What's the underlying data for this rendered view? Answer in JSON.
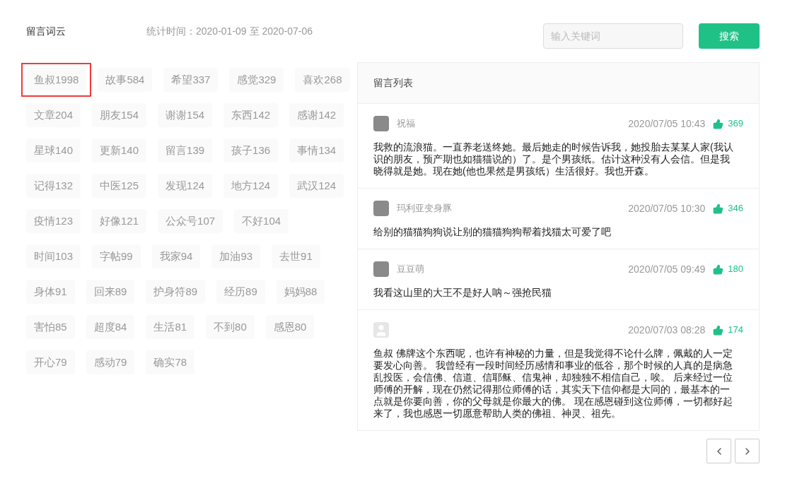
{
  "cloud": {
    "title": "留言词云",
    "stats_period": "统计时间：2020-01-09 至 2020-07-06",
    "tags": [
      {
        "label": "鱼叔1998",
        "selected": true
      },
      {
        "label": "故事584",
        "selected": false
      },
      {
        "label": "希望337",
        "selected": false
      },
      {
        "label": "感觉329",
        "selected": false
      },
      {
        "label": "喜欢268",
        "selected": false
      },
      {
        "label": "文章204",
        "selected": false
      },
      {
        "label": "朋友154",
        "selected": false
      },
      {
        "label": "谢谢154",
        "selected": false
      },
      {
        "label": "东西142",
        "selected": false
      },
      {
        "label": "感谢142",
        "selected": false
      },
      {
        "label": "星球140",
        "selected": false
      },
      {
        "label": "更新140",
        "selected": false
      },
      {
        "label": "留言139",
        "selected": false
      },
      {
        "label": "孩子136",
        "selected": false
      },
      {
        "label": "事情134",
        "selected": false
      },
      {
        "label": "记得132",
        "selected": false
      },
      {
        "label": "中医125",
        "selected": false
      },
      {
        "label": "发现124",
        "selected": false
      },
      {
        "label": "地方124",
        "selected": false
      },
      {
        "label": "武汉124",
        "selected": false
      },
      {
        "label": "疫情123",
        "selected": false
      },
      {
        "label": "好像121",
        "selected": false
      },
      {
        "label": "公众号107",
        "selected": false
      },
      {
        "label": "不好104",
        "selected": false
      },
      {
        "label": "时间103",
        "selected": false
      },
      {
        "label": "字帖99",
        "selected": false
      },
      {
        "label": "我家94",
        "selected": false
      },
      {
        "label": "加油93",
        "selected": false
      },
      {
        "label": "去世91",
        "selected": false
      },
      {
        "label": "身体91",
        "selected": false
      },
      {
        "label": "回来89",
        "selected": false
      },
      {
        "label": "护身符89",
        "selected": false
      },
      {
        "label": "经历89",
        "selected": false
      },
      {
        "label": "妈妈88",
        "selected": false
      },
      {
        "label": "害怕85",
        "selected": false
      },
      {
        "label": "超度84",
        "selected": false
      },
      {
        "label": "生活81",
        "selected": false
      },
      {
        "label": "不到80",
        "selected": false
      },
      {
        "label": "感恩80",
        "selected": false
      },
      {
        "label": "开心79",
        "selected": false
      },
      {
        "label": "感动79",
        "selected": false
      },
      {
        "label": "确实78",
        "selected": false
      }
    ]
  },
  "search": {
    "placeholder": "输入关键词",
    "button": "搜索"
  },
  "comments_panel": {
    "title": "留言列表",
    "comments": [
      {
        "kind": "photo_avatar",
        "name": "祝福",
        "time": "2020/07/05 10:43",
        "likes": "369",
        "text": "我救的流浪猫。一直养老送终她。最后她走的时候告诉我，她投胎去某某人家(我认识的朋友，预产期也如猫猫说的）了。是个男孩纸。估计这种没有人会信。但是我晓得就是她。现在她(他也果然是男孩纸）生活很好。我也开森。"
      },
      {
        "kind": "photo_avatar",
        "name": "玛利亚变身豚",
        "time": "2020/07/05 10:30",
        "likes": "346",
        "text": "给别的猫猫狗狗说让别的猫猫狗狗帮着找猫太可爱了吧"
      },
      {
        "kind": "photo_avatar",
        "name": "豆豆萌",
        "time": "2020/07/05 09:49",
        "likes": "180",
        "text": "我看这山里的大王不是好人呐～强抢民猫"
      },
      {
        "kind": "default_avatar",
        "time": "2020/07/03 08:28",
        "likes": "174",
        "text": "鱼叔 佛牌这个东西呢，也许有神秘的力量，但是我觉得不论什么牌，佩戴的人一定要发心向善。 我曾经有一段时间经历感情和事业的低谷，那个时候的人真的是病急乱投医，会信佛、信道、信耶稣、信鬼神，却独独不相信自己，唉。 后来经过一位师傅的开解，现在仍然记得那位师傅的话，其实天下信仰都是大同的，最基本的一点就是你要向善，你的父母就是你最大的佛。 现在感恩碰到这位师傅，一切都好起来了，我也感恩一切愿意帮助人类的佛祖、神灵、祖先。"
      }
    ]
  }
}
